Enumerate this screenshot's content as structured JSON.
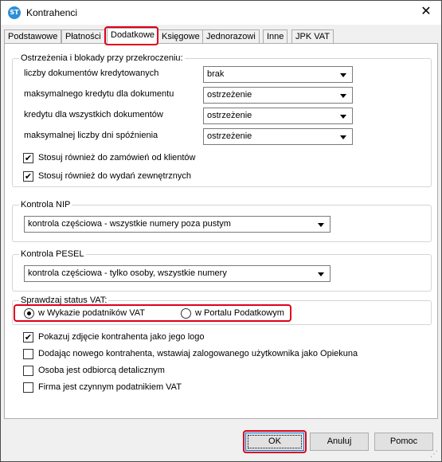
{
  "window": {
    "title": "Kontrahenci",
    "icon_name": "app-logo-icon",
    "icon_text": "ST",
    "close_glyph": "✕"
  },
  "tabs": [
    {
      "label": "Podstawowe",
      "active": false
    },
    {
      "label": "Płatności",
      "active": false
    },
    {
      "label": "Dodatkowe",
      "active": true
    },
    {
      "label": "Księgowe",
      "active": false
    },
    {
      "label": "Jednorazowi",
      "active": false
    },
    {
      "label": "Inne",
      "active": false
    },
    {
      "label": "JPK VAT",
      "active": false
    }
  ],
  "warnings": {
    "legend": "Ostrzeżenia i blokady przy przekroczeniu:",
    "rows": [
      {
        "label": "liczby dokumentów kredytowanych",
        "value": "brak"
      },
      {
        "label": "maksymalnego kredytu dla  dokumentu",
        "value": "ostrzeżenie"
      },
      {
        "label": "kredytu dla wszystkich dokumentów",
        "value": "ostrzeżenie"
      },
      {
        "label": "maksymalnej liczby dni spóźnienia",
        "value": "ostrzeżenie"
      }
    ],
    "checks": [
      {
        "label": "Stosuj również do zamówień od klientów",
        "checked": true
      },
      {
        "label": "Stosuj również do wydań zewnętrznych",
        "checked": true
      }
    ]
  },
  "nip": {
    "legend": "Kontrola NIP",
    "value": "kontrola częściowa - wszystkie numery poza pustym"
  },
  "pesel": {
    "legend": "Kontrola PESEL",
    "value": "kontrola częściowa - tylko osoby, wszystkie numery"
  },
  "vat_status": {
    "legend": "Sprawdzaj status VAT:",
    "options": [
      {
        "label": "w Wykazie podatników VAT",
        "selected": true
      },
      {
        "label": "w Portalu Podatkowym",
        "selected": false
      }
    ]
  },
  "options": [
    {
      "label": "Pokazuj zdjęcie kontrahenta jako jego logo",
      "checked": true
    },
    {
      "label": "Dodając nowego kontrahenta, wstawiaj zalogowanego użytkownika jako Opiekuna",
      "checked": false
    },
    {
      "label": "Osoba jest odbiorcą detalicznym",
      "checked": false
    },
    {
      "label": "Firma jest czynnym podatnikiem VAT",
      "checked": false
    }
  ],
  "buttons": {
    "ok": "OK",
    "cancel": "Anuluj",
    "help": "Pomoc"
  },
  "glyphs": {
    "check": "✔"
  },
  "colors": {
    "highlight": "#e0001b",
    "title_bar": "#ffffff",
    "dialog_bg": "#f0f0f0",
    "icon_blue": "#2e8fd6"
  }
}
